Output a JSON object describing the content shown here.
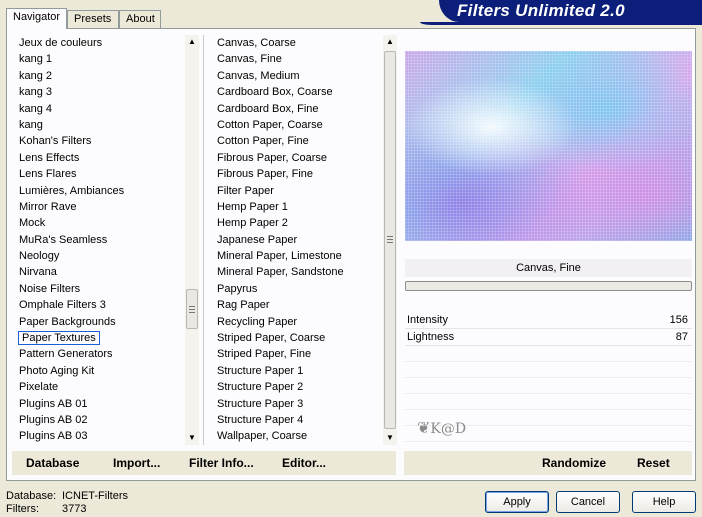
{
  "app": {
    "title": "Filters Unlimited 2.0"
  },
  "tabs": [
    {
      "label": "Navigator",
      "active": true
    },
    {
      "label": "Presets",
      "active": false
    },
    {
      "label": "About",
      "active": false
    }
  ],
  "categories": {
    "items": [
      "Jeux de couleurs",
      "kang 1",
      "kang 2",
      "kang 3",
      "kang 4",
      "kang",
      "Kohan's Filters",
      "Lens Effects",
      "Lens Flares",
      "Lumières, Ambiances",
      "Mirror Rave",
      "Mock",
      "MuRa's Seamless",
      "Neology",
      "Nirvana",
      "Noise Filters",
      "Omphale Filters 3",
      "Paper Backgrounds",
      "Paper Textures",
      "Pattern Generators",
      "Photo Aging Kit",
      "Pixelate",
      "Plugins AB 01",
      "Plugins AB 02",
      "Plugins AB 03"
    ],
    "selected": "Paper Textures"
  },
  "filters": {
    "items": [
      "Canvas, Coarse",
      "Canvas, Fine",
      "Canvas, Medium",
      "Cardboard Box, Coarse",
      "Cardboard Box, Fine",
      "Cotton Paper, Coarse",
      "Cotton Paper, Fine",
      "Fibrous Paper, Coarse",
      "Fibrous Paper, Fine",
      "Filter Paper",
      "Hemp Paper 1",
      "Hemp Paper 2",
      "Japanese Paper",
      "Mineral Paper, Limestone",
      "Mineral Paper, Sandstone",
      "Papyrus",
      "Rag Paper",
      "Recycling Paper",
      "Striped Paper, Coarse",
      "Striped Paper, Fine",
      "Structure Paper 1",
      "Structure Paper 2",
      "Structure Paper 3",
      "Structure Paper 4",
      "Wallpaper, Coarse"
    ],
    "selected": "Canvas, Fine"
  },
  "preview": {
    "filter_name": "Canvas, Fine",
    "watermark": "K@D"
  },
  "params": [
    {
      "label": "Intensity",
      "value": "156"
    },
    {
      "label": "Lightness",
      "value": "87"
    }
  ],
  "toolbar": {
    "database": "Database",
    "import": "Import...",
    "filter_info": "Filter Info...",
    "editor": "Editor...",
    "randomize": "Randomize",
    "reset": "Reset"
  },
  "status": {
    "database_label": "Database:",
    "database_value": "ICNET-Filters",
    "filters_label": "Filters:",
    "filters_value": "3773"
  },
  "buttons": {
    "apply": "Apply",
    "cancel": "Cancel",
    "help": "Help"
  },
  "colors": {
    "banner": "#0a1e7a",
    "selection": "#316ac5",
    "focus": "#1a5dd6"
  }
}
